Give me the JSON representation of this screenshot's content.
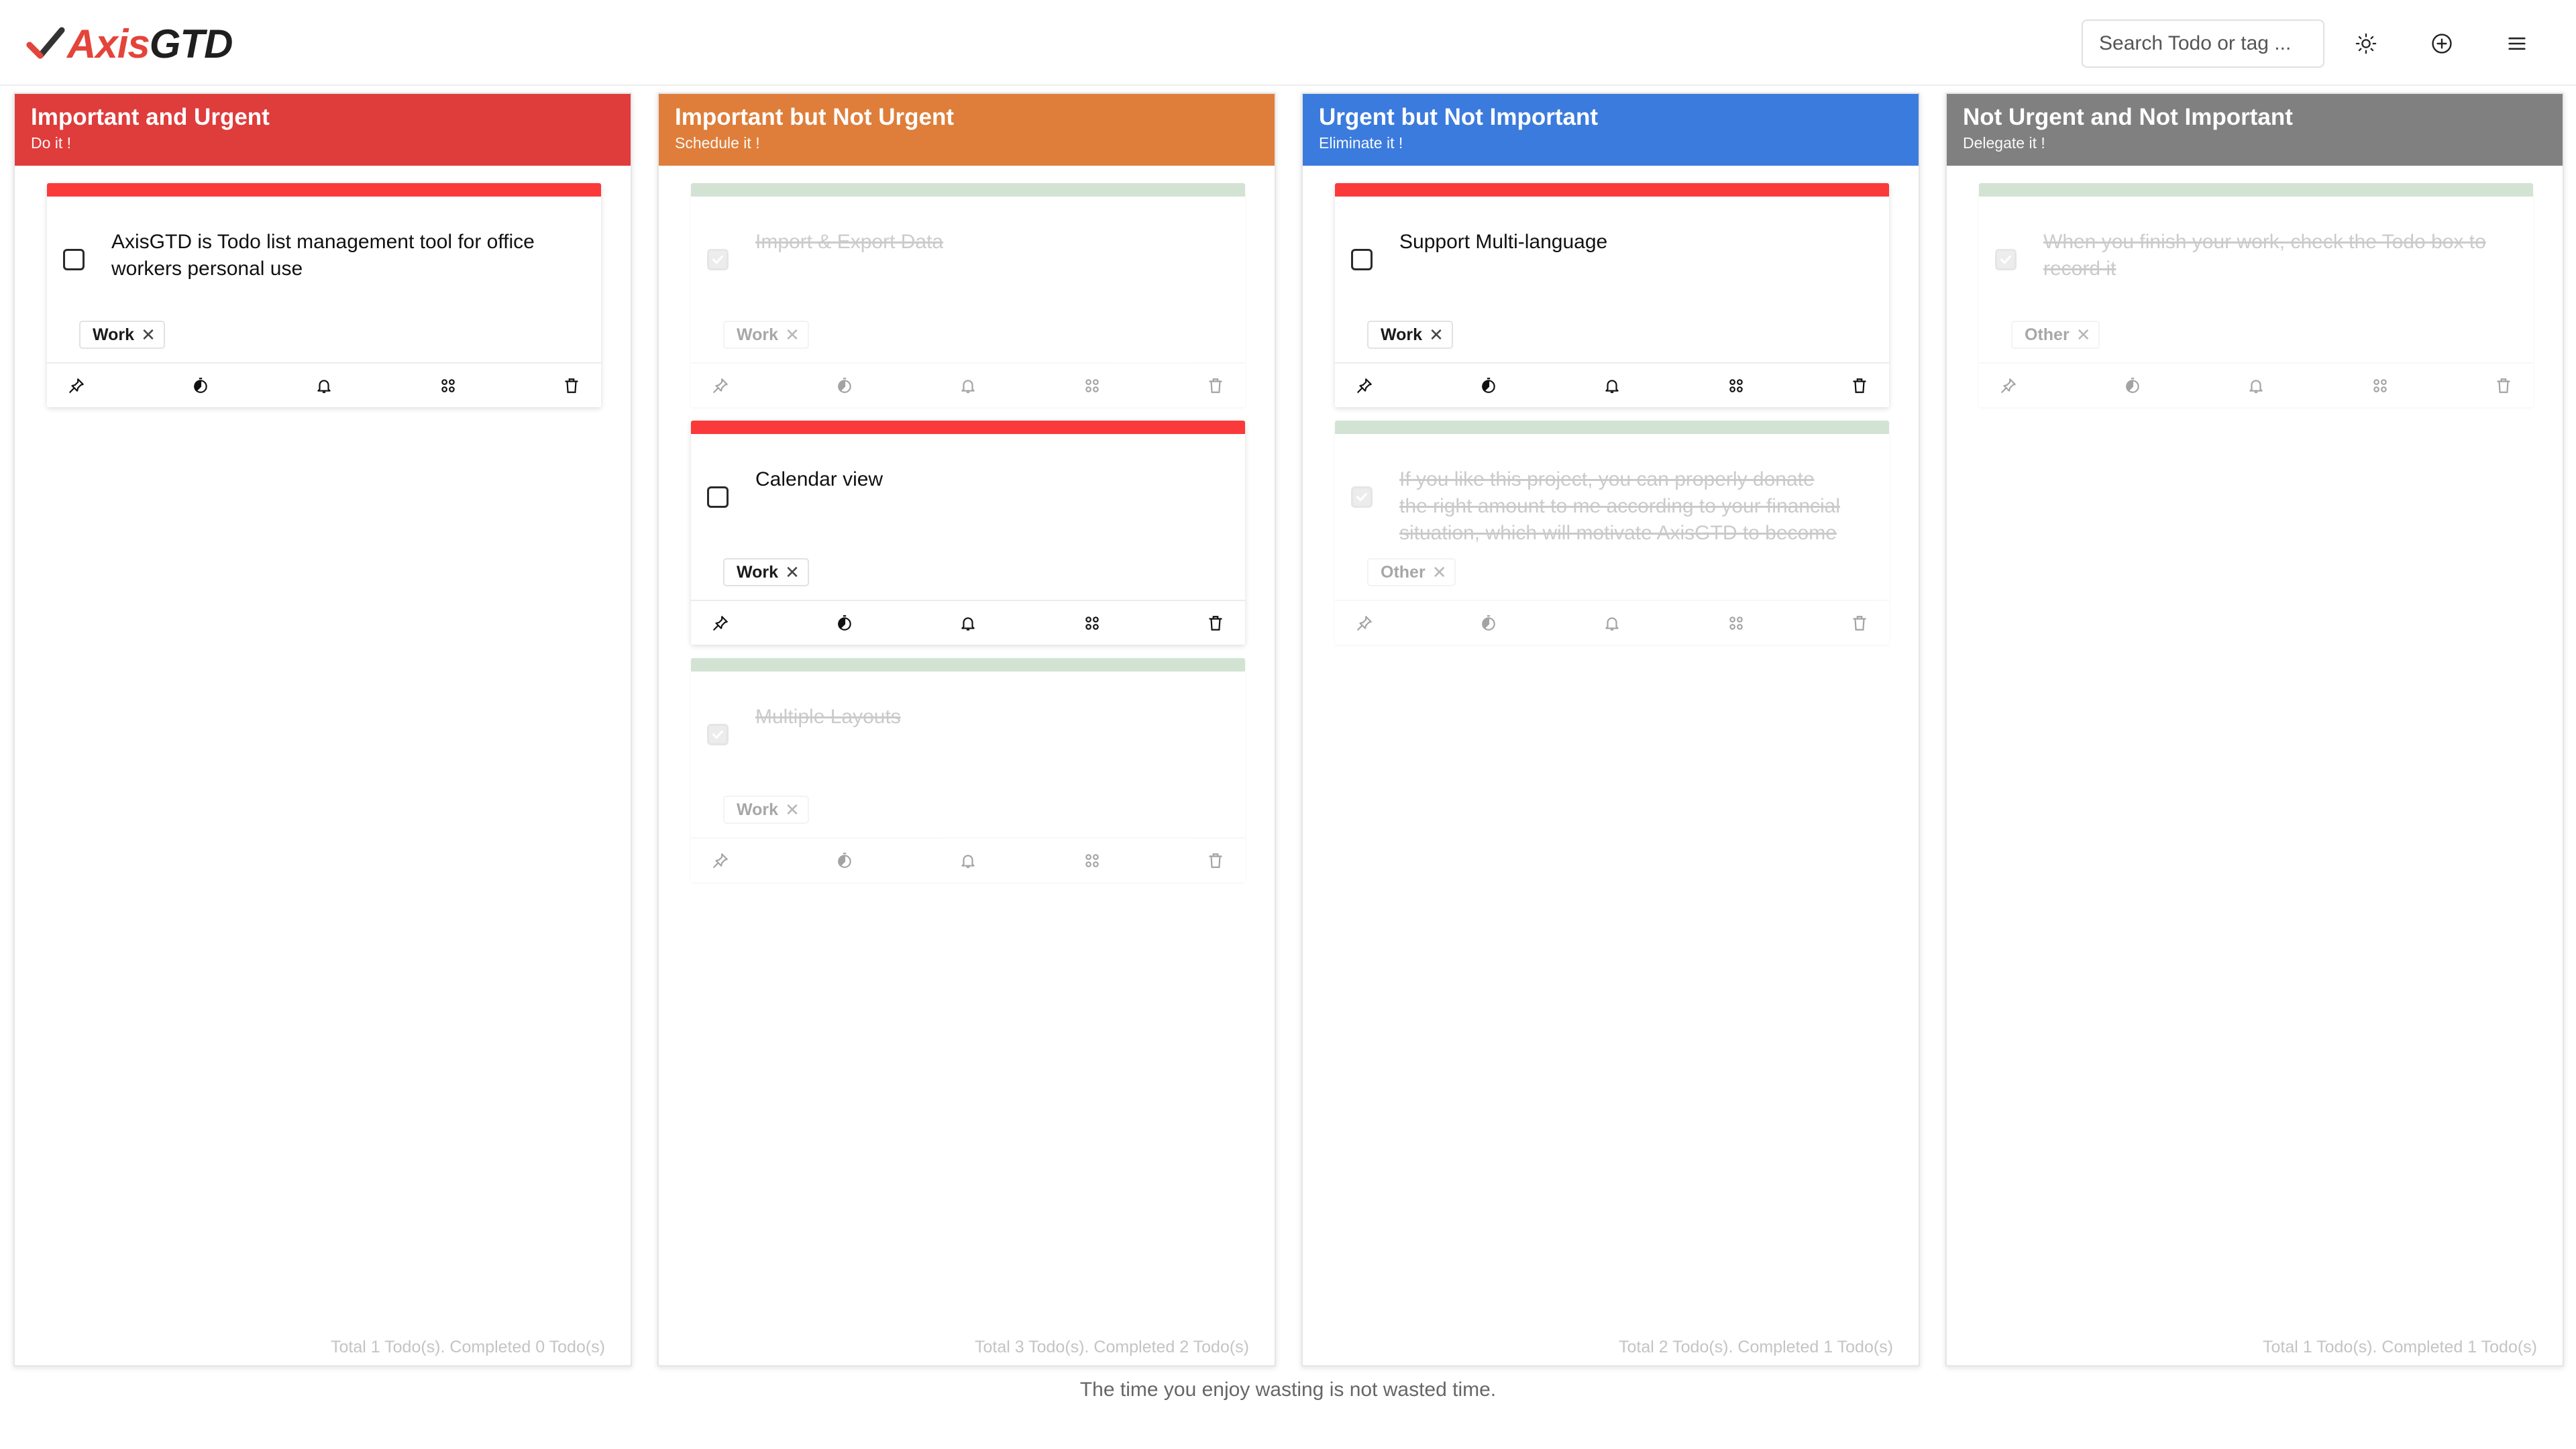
{
  "app": {
    "logo_parts": [
      "Axis",
      "GTD"
    ],
    "search_placeholder": "Search Todo or tag ..."
  },
  "header_icons": [
    "sun-icon",
    "plus-circle-icon",
    "hamburger-menu-icon"
  ],
  "columns": [
    {
      "title": "Important and Urgent",
      "subtitle": "Do it !",
      "color": "#df3c3c",
      "footer": "Total 1 Todo(s). Completed 0 Todo(s)",
      "todos": [
        {
          "text": "AxisGTD is Todo list management tool for office workers personal use",
          "tag": "Work",
          "done": false
        }
      ]
    },
    {
      "title": "Important but Not Urgent",
      "subtitle": "Schedule it !",
      "color": "#de7e3a",
      "footer": "Total 3 Todo(s). Completed 2 Todo(s)",
      "todos": [
        {
          "text": "Import & Export Data",
          "tag": "Work",
          "done": true
        },
        {
          "text": "Calendar view",
          "tag": "Work",
          "done": false
        },
        {
          "text": "Multiple Layouts",
          "tag": "Work",
          "done": true
        }
      ]
    },
    {
      "title": "Urgent but Not Important",
      "subtitle": "Eliminate it !",
      "color": "#3b7bdd",
      "footer": "Total 2 Todo(s). Completed 1 Todo(s)",
      "todos": [
        {
          "text": "Support Multi-language",
          "tag": "Work",
          "done": false
        },
        {
          "text": "If you like this project, you can properly donate the right amount to me according to your financial situation, which will motivate AxisGTD to become",
          "tag": "Other",
          "done": true
        }
      ]
    },
    {
      "title": "Not Urgent and Not Important",
      "subtitle": "Delegate it !",
      "color": "#808080",
      "footer": "Total 1 Todo(s). Completed 1 Todo(s)",
      "todos": [
        {
          "text": "When you finish your work, check the Todo box to record it",
          "tag": "Other",
          "done": true
        }
      ]
    }
  ],
  "card_actions": [
    "pin-icon",
    "timer-icon",
    "bell-icon",
    "command-icon",
    "trash-icon"
  ],
  "quote": "The time you enjoy wasting is not wasted time."
}
